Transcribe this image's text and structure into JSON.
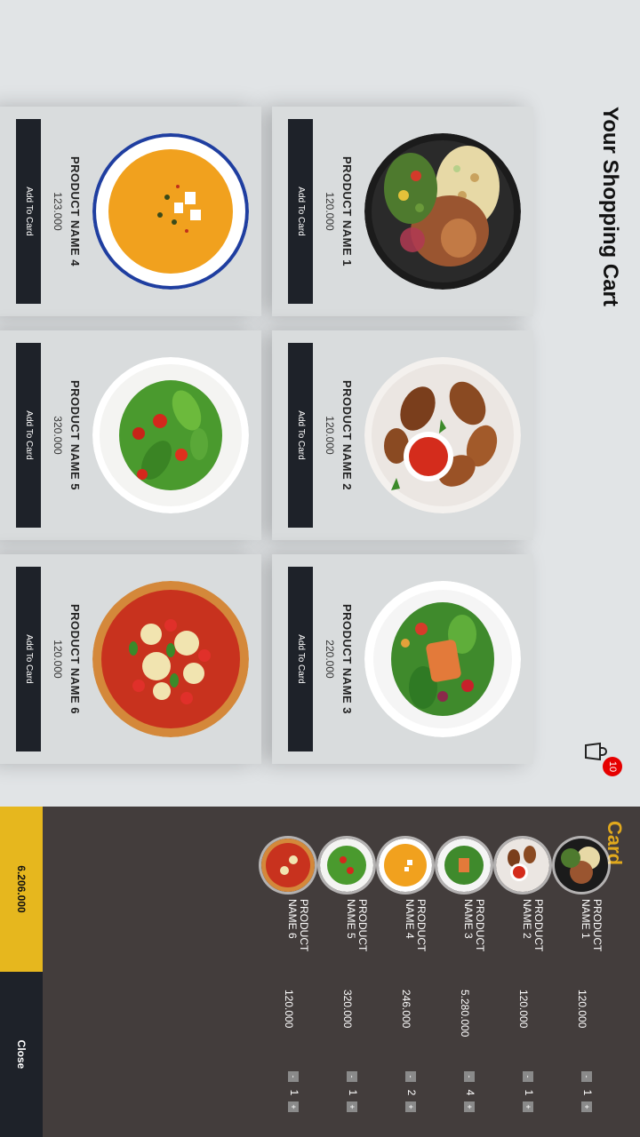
{
  "header": {
    "title": "Your Shopping Cart",
    "cart_icon": "shopping-bag-icon",
    "cart_count": "10"
  },
  "products": [
    {
      "name": "PRODUCT NAME 1",
      "price": "120.000",
      "button": "Add To Card",
      "image": "grain-bowl"
    },
    {
      "name": "PRODUCT NAME 2",
      "price": "120.000",
      "button": "Add To Card",
      "image": "chicken-wings"
    },
    {
      "name": "PRODUCT NAME 3",
      "price": "220.000",
      "button": "Add To Card",
      "image": "salmon-salad"
    },
    {
      "name": "PRODUCT NAME 4",
      "price": "123.000",
      "button": "Add To Card",
      "image": "pumpkin-soup"
    },
    {
      "name": "PRODUCT NAME 5",
      "price": "320.000",
      "button": "Add To Card",
      "image": "green-salad"
    },
    {
      "name": "PRODUCT NAME 6",
      "price": "120.000",
      "button": "Add To Card",
      "image": "pizza"
    }
  ],
  "cart": {
    "title": "Card",
    "items": [
      {
        "name": "PRODUCT NAME 1",
        "price": "120.000",
        "qty": "1",
        "minus": "-",
        "plus": "+"
      },
      {
        "name": "PRODUCT NAME 2",
        "price": "120.000",
        "qty": "1",
        "minus": "-",
        "plus": "+"
      },
      {
        "name": "PRODUCT NAME 3",
        "price": "5.280.000",
        "qty": "4",
        "minus": "-",
        "plus": "+"
      },
      {
        "name": "PRODUCT NAME 4",
        "price": "246.000",
        "qty": "2",
        "minus": "-",
        "plus": "+"
      },
      {
        "name": "PRODUCT NAME 5",
        "price": "320.000",
        "qty": "1",
        "minus": "-",
        "plus": "+"
      },
      {
        "name": "PRODUCT NAME 6",
        "price": "120.000",
        "qty": "1",
        "minus": "-",
        "plus": "+"
      }
    ],
    "total": "6.206.000",
    "close_label": "Close"
  },
  "colors": {
    "accent": "#e6b71e",
    "cart_bg": "#433d3c",
    "button_bg": "#1e2229",
    "badge": "#e60000"
  }
}
